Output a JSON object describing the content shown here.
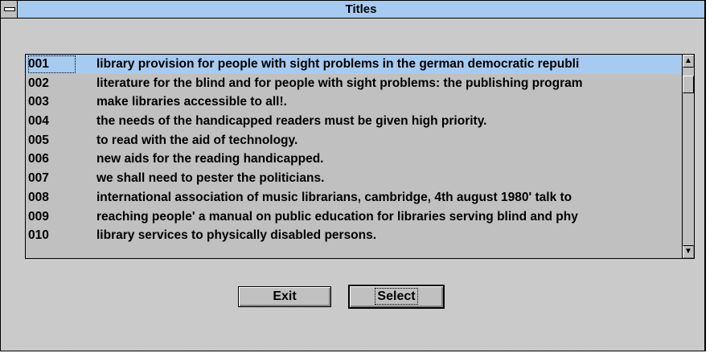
{
  "window": {
    "title": "Titles",
    "colors": {
      "titlebar": "#a6caf0",
      "selection": "#a6caf0",
      "face": "#c0c0c0"
    }
  },
  "system_menu": {
    "icon": "minus-bar-icon"
  },
  "titles_list": {
    "selected_index": 0,
    "items": [
      {
        "num": "001",
        "title": "library provision for people with sight problems in the german democratic  republi"
      },
      {
        "num": "002",
        "title": "literature for the blind and for people with sight problems: the publishing  program"
      },
      {
        "num": "003",
        "title": "make libraries accessible to all!."
      },
      {
        "num": "004",
        "title": "the needs of the handicapped readers must be given high priority."
      },
      {
        "num": "005",
        "title": "to read with the aid of technology."
      },
      {
        "num": "006",
        "title": "new aids for the reading handicapped."
      },
      {
        "num": "007",
        "title": "we shall need to pester the politicians."
      },
      {
        "num": "008",
        "title": "international association of music librarians, cambridge, 4th august 1980'  talk to"
      },
      {
        "num": "009",
        "title": "reaching people' a manual on public education for libraries serving blind and  phy"
      },
      {
        "num": "010",
        "title": "library services to physically disabled persons."
      }
    ]
  },
  "scrollbar": {
    "up_glyph": "▲",
    "down_glyph": "▼",
    "up_icon": "arrow-up-icon",
    "down_icon": "arrow-down-icon"
  },
  "buttons": {
    "exit_label": "Exit",
    "select_label": "Select"
  }
}
